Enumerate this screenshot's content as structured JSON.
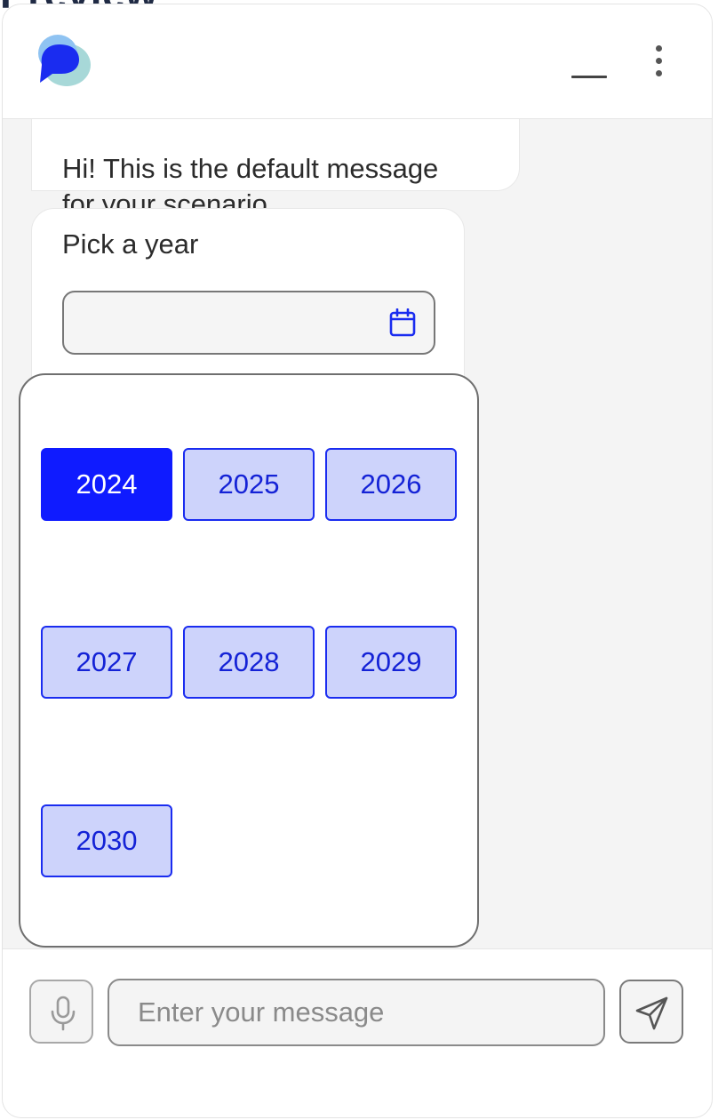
{
  "background": {
    "title": "Preview"
  },
  "header": {
    "logo_icon": "chat-bubble-logo",
    "minimize_icon": "minimize-icon",
    "menu_icon": "more-vertical-icon"
  },
  "messages": {
    "greeting_line1": "Hi! This is the default message",
    "greeting_line2": "for your scenario",
    "prompt": "Pick a year"
  },
  "date_picker": {
    "value": "",
    "calendar_icon": "calendar-icon",
    "years": [
      "2024",
      "2025",
      "2026",
      "2027",
      "2028",
      "2029",
      "2030"
    ],
    "selected": "2024"
  },
  "composer": {
    "placeholder": "Enter your message",
    "mic_icon": "microphone-icon",
    "send_icon": "send-icon"
  },
  "colors": {
    "accent": "#0f1bff",
    "year_bg": "#cdd3fb",
    "year_text": "#1422d6"
  }
}
